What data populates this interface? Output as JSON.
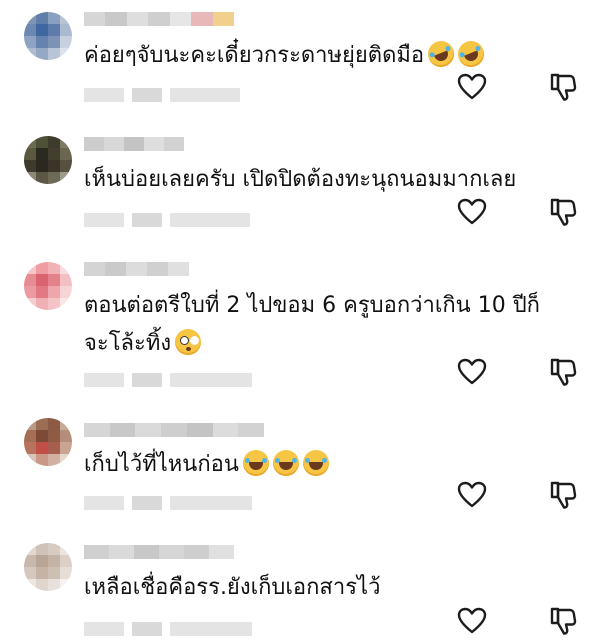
{
  "comments": [
    {
      "text_lines": [
        "ค่อยๆจับนะคะเดี๋ยวกระดาษยุ่ยติดมือ"
      ],
      "emojis": [
        "rolling-on-floor-laughing",
        "rolling-on-floor-laughing"
      ],
      "avatar_colors": [
        "#7f95b4",
        "#5f7fa8",
        "#8aa0c0",
        "#b7c4d6",
        "#6b88b0",
        "#3f67a0",
        "#5d7cab",
        "#a9b9cf",
        "#8ea3c2",
        "#6683b0",
        "#7c93b6",
        "#c6d0de",
        "#aebbd0",
        "#95a8c6",
        "#b8c5d8",
        "#dde3ec"
      ],
      "name_colors": [
        "#d6d6d6",
        "#c9c9c9",
        "#dedede",
        "#cfcfcf",
        "#e6e6e6",
        "#e8b8b8",
        "#f0d08c"
      ]
    },
    {
      "text_lines": [
        "เห็นบ่อยเลยครับ เปิดปิดต้องทะนุถนอมมากเลย"
      ],
      "emojis": [],
      "avatar_colors": [
        "#6b6a52",
        "#4f5038",
        "#3d3b2b",
        "#7b7a63",
        "#5a583f",
        "#2b2a20",
        "#433f2e",
        "#6a6650",
        "#3e3a2c",
        "#2c271f",
        "#3b3428",
        "#55503f",
        "#8b8a78",
        "#5c5645",
        "#6e6a58",
        "#9c9a8a"
      ],
      "name_colors": [
        "#cdcdcd",
        "#d8d8d8",
        "#c4c4c4",
        "#dedede",
        "#d2d2d2"
      ]
    },
    {
      "text_lines": [
        "ตอนต่อตรีใบที่ 2 ไปขอม 6 ครูบอกว่าเกิน 10 ปีก็",
        "จะโล้ะทิ้ง"
      ],
      "emojis": [
        "flushed-face"
      ],
      "avatar_colors": [
        "#f3c6c8",
        "#ee9ea3",
        "#f1b1b5",
        "#f8dcde",
        "#e88c93",
        "#d9646f",
        "#e4818a",
        "#f2c0c3",
        "#ec9aa1",
        "#e27882",
        "#eea5ab",
        "#f6d3d5",
        "#f4cfd1",
        "#efb0b5",
        "#f3c3c6",
        "#fae6e7"
      ],
      "name_colors": [
        "#d4d4d4",
        "#cacaca",
        "#dcdcdc",
        "#d0d0d0",
        "#e0e0e0"
      ]
    },
    {
      "text_lines": [
        "เก็บไว้ที่ไหนก่อน"
      ],
      "emojis": [
        "face-with-tears-of-joy",
        "face-with-tears-of-joy",
        "face-with-tears-of-joy"
      ],
      "avatar_colors": [
        "#b99a86",
        "#9c6d55",
        "#8c5a45",
        "#c7ab99",
        "#a46f56",
        "#7d4a37",
        "#8e5b45",
        "#b48e7a",
        "#b8735e",
        "#c24f46",
        "#a85e4e",
        "#c9a493",
        "#d8c3b6",
        "#c99886",
        "#d2b0a1",
        "#e6d7ce"
      ],
      "name_colors": [
        "#d6d6d6",
        "#c8c8c8",
        "#dadada",
        "#cecece",
        "#c4c4c4",
        "#dcdcdc",
        "#d2d2d2"
      ]
    },
    {
      "text_lines": [
        "เหลือเชื่อคือรร.ยังเก็บเอกสารไว้"
      ],
      "emojis": [],
      "avatar_colors": [
        "#e2d8d0",
        "#cfc2b8",
        "#d8ccc2",
        "#ece5df",
        "#c8b8ab",
        "#b9a596",
        "#c4b2a4",
        "#dcd0c6",
        "#d6c8bd",
        "#c5b3a5",
        "#cebfb3",
        "#e5ddd6",
        "#ede7e2",
        "#e0d6ce",
        "#e8e1db",
        "#f5f2ef"
      ],
      "name_colors": [
        "#d0d0d0",
        "#dadada",
        "#c8c8c8",
        "#d6d6d6",
        "#cecece",
        "#e0e0e0"
      ]
    }
  ],
  "icons": {
    "like": "heart-outline-icon",
    "dislike": "thumbs-down-outline-icon"
  },
  "colors": {
    "text": "#111111",
    "icon": "#1c1c1c",
    "meta_placeholder": "#e4e4e4"
  }
}
